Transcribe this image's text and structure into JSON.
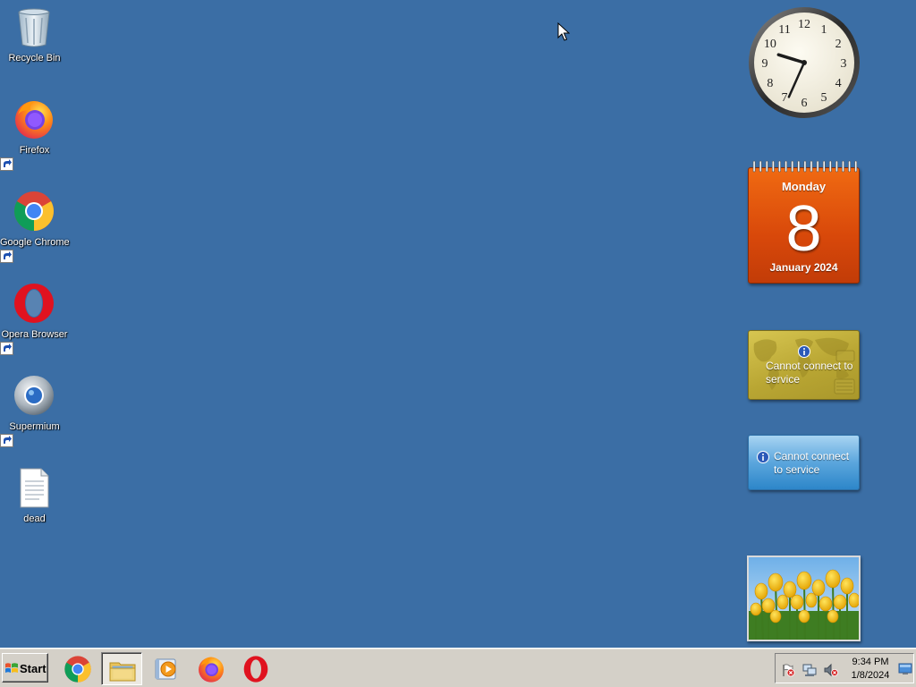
{
  "desktop": {
    "background_color": "#3b6ea5",
    "icons": [
      {
        "label": "Recycle Bin",
        "icon": "recycle-bin-icon",
        "shortcut": false
      },
      {
        "label": "Firefox",
        "icon": "firefox-icon",
        "shortcut": true
      },
      {
        "label": "Google Chrome",
        "icon": "chrome-icon",
        "shortcut": true
      },
      {
        "label": "Opera Browser",
        "icon": "opera-icon",
        "shortcut": true
      },
      {
        "label": "Supermium",
        "icon": "supermium-icon",
        "shortcut": true
      },
      {
        "label": "dead",
        "icon": "text-file-icon",
        "shortcut": false
      }
    ]
  },
  "gadgets": {
    "clock": {
      "hour_numerals": [
        "12",
        "1",
        "2",
        "3",
        "4",
        "5",
        "6",
        "7",
        "8",
        "9",
        "10",
        "11"
      ],
      "time": "9:34"
    },
    "calendar": {
      "weekday": "Monday",
      "day": "8",
      "month_year": "January 2024",
      "color": "#e0520c"
    },
    "currency": {
      "message": "Cannot connect to service",
      "color": "#c4b140"
    },
    "weather": {
      "message": "Cannot connect to service",
      "color": "#5ba6dd"
    },
    "slideshow": {
      "subject": "yellow-tulips"
    }
  },
  "taskbar": {
    "start_label": "Start",
    "pinned": [
      {
        "name": "Google Chrome",
        "icon": "chrome-icon",
        "active": false
      },
      {
        "name": "Windows Explorer",
        "icon": "explorer-folder-icon",
        "active": true
      },
      {
        "name": "Windows Media Player",
        "icon": "media-player-icon",
        "active": false
      },
      {
        "name": "Firefox",
        "icon": "firefox-icon",
        "active": false
      },
      {
        "name": "Opera",
        "icon": "opera-icon",
        "active": false
      }
    ],
    "tray": {
      "icons": [
        "action-center-flag-icon",
        "network-icon",
        "volume-muted-icon"
      ],
      "time": "9:34 PM",
      "date": "1/8/2024"
    }
  }
}
